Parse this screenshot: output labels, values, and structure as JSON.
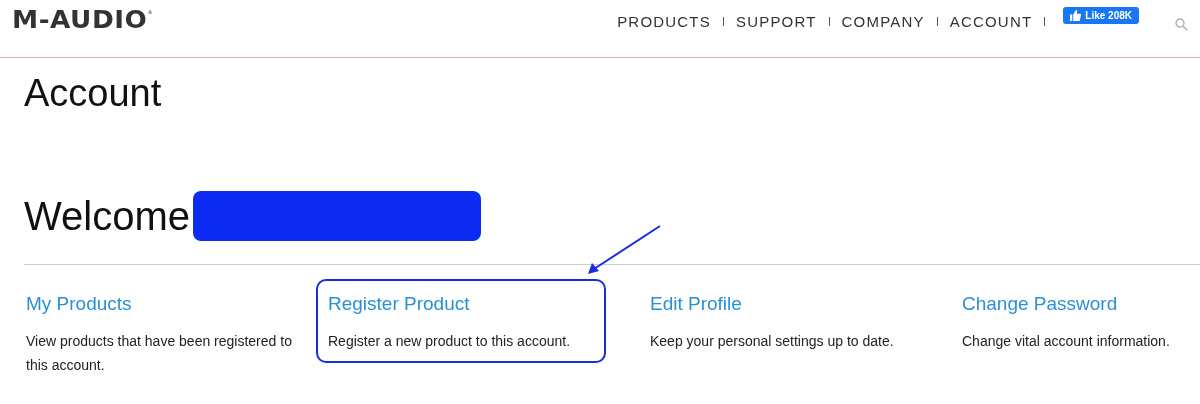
{
  "header": {
    "logo": "M-AUDIO",
    "logo_mark": "®",
    "nav": [
      {
        "label": "PRODUCTS"
      },
      {
        "label": "SUPPORT"
      },
      {
        "label": "COMPANY"
      },
      {
        "label": "ACCOUNT"
      }
    ],
    "like_button": {
      "label": "Like 208K"
    }
  },
  "page_title": "Account",
  "welcome": {
    "text": "Welcome",
    "redacted": true
  },
  "cards": [
    {
      "title": "My Products",
      "description": "View products that have been registered to this account.",
      "highlighted": false
    },
    {
      "title": "Register Product",
      "description": "Register a new product to this account.",
      "highlighted": true
    },
    {
      "title": "Edit Profile",
      "description": "Keep your personal settings up to date.",
      "highlighted": false
    },
    {
      "title": "Change Password",
      "description": "Change vital account information.",
      "highlighted": false
    }
  ]
}
